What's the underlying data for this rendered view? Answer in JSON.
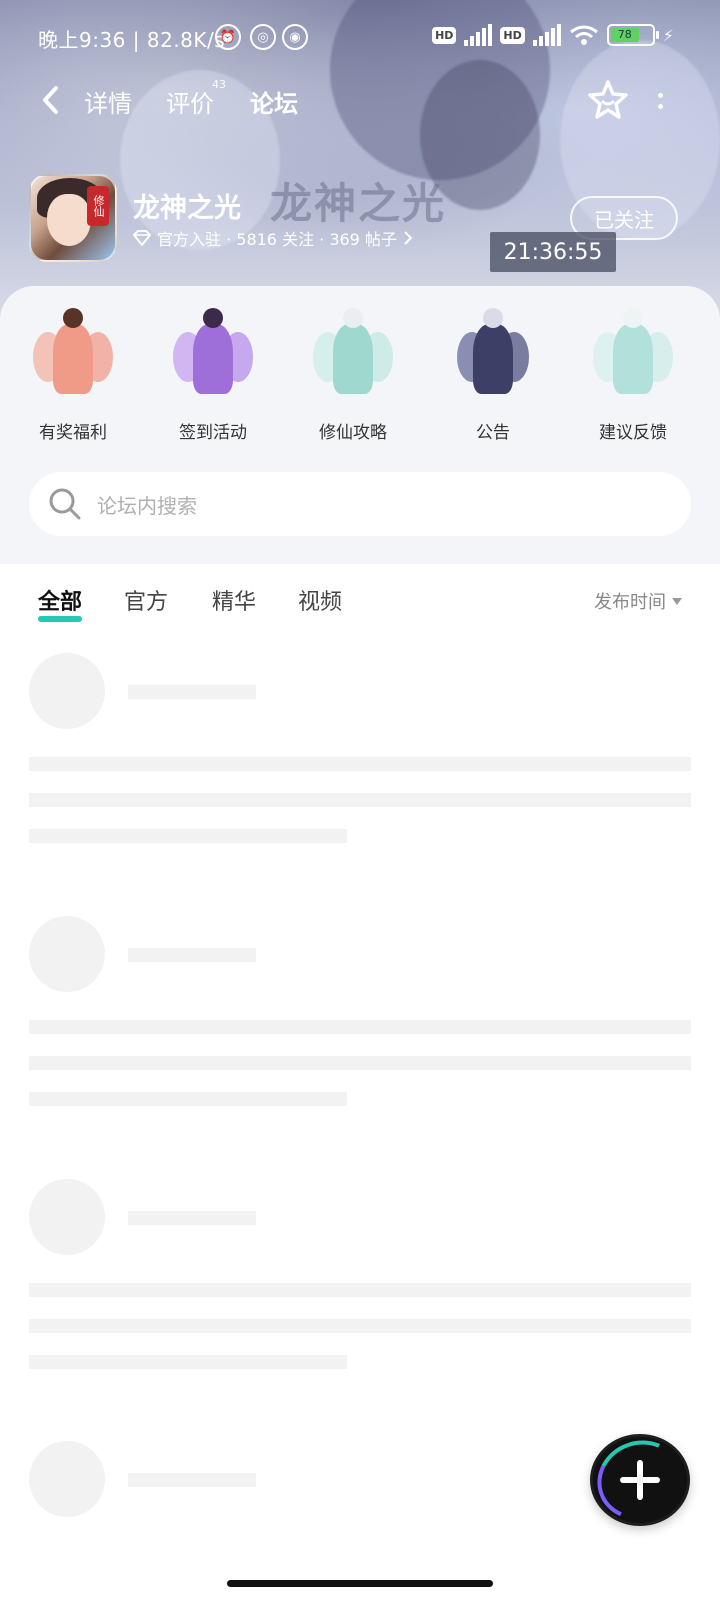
{
  "status_bar": {
    "time_text": "晚上9:36 | 82.8K/s",
    "battery": "78",
    "network": "5G"
  },
  "nav": {
    "tabs": [
      {
        "label": "详情"
      },
      {
        "label": "评价",
        "badge": "43"
      },
      {
        "label": "论坛",
        "active": true
      }
    ]
  },
  "game": {
    "name": "龙神之光",
    "watermark": "龙神之光",
    "meta": "官方入驻 · 5816 关注 · 369 帖子",
    "follow_label": "已关注",
    "seal_text": "修仙",
    "clock": "21:36:55"
  },
  "shortcuts": [
    {
      "label": "有奖福利"
    },
    {
      "label": "签到活动"
    },
    {
      "label": "修仙攻略"
    },
    {
      "label": "公告"
    },
    {
      "label": "建议反馈"
    }
  ],
  "search": {
    "placeholder": "论坛内搜索"
  },
  "feed_tabs": [
    {
      "label": "全部",
      "active": true
    },
    {
      "label": "官方"
    },
    {
      "label": "精华"
    },
    {
      "label": "视频"
    }
  ],
  "sort": {
    "label": "发布时间"
  },
  "colors": {
    "accent": "#27c7b2",
    "skeleton": "#f2f2f2"
  }
}
